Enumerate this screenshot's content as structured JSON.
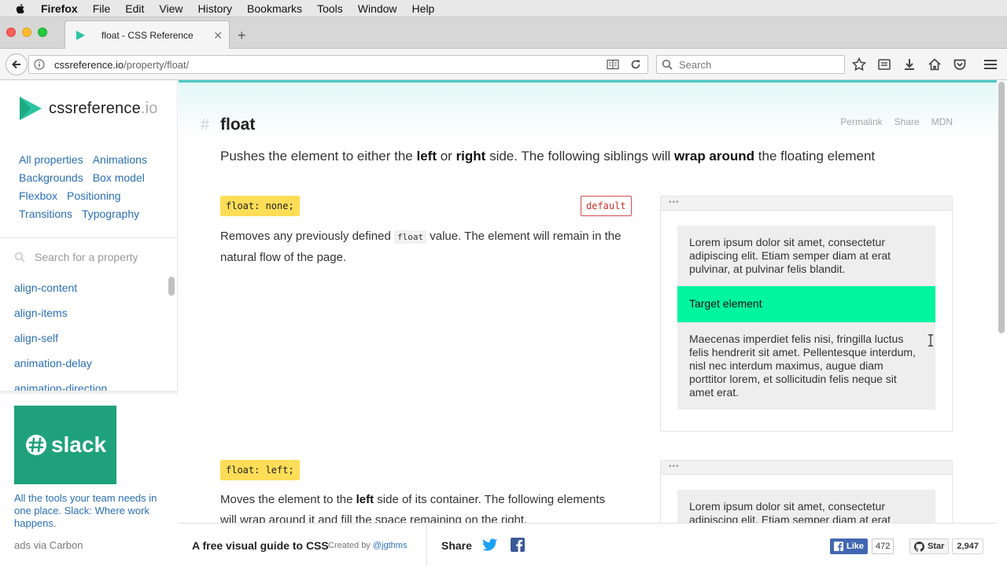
{
  "menubar": {
    "app": "Firefox",
    "items": [
      "File",
      "Edit",
      "View",
      "History",
      "Bookmarks",
      "Tools",
      "Window",
      "Help"
    ]
  },
  "tab": {
    "title": "float - CSS Reference"
  },
  "navbar": {
    "url_host": "cssreference.io",
    "url_path": "/property/float/",
    "search_placeholder": "Search"
  },
  "sidebar": {
    "logo_word": "cssreference",
    "logo_tld": ".io",
    "categories": [
      "All properties",
      "Animations",
      "Backgrounds",
      "Box model",
      "Flexbox",
      "Positioning",
      "Transitions",
      "Typography"
    ],
    "search_placeholder": "Search for a property",
    "properties": [
      "align-content",
      "align-items",
      "align-self",
      "animation-delay",
      "animation-direction"
    ]
  },
  "ad": {
    "brand": "slack",
    "copy": "All the tools your team needs in one place. Slack: Where work happens.",
    "via": "ads via Carbon"
  },
  "page": {
    "title": "float",
    "links": [
      "Permalink",
      "Share",
      "MDN"
    ],
    "lead": {
      "p1": "Pushes the element to either the ",
      "b1": "left",
      "p2": " or ",
      "b2": "right",
      "p3": " side. The following siblings will ",
      "b3": "wrap around",
      "p4": " the floating element"
    },
    "examples": [
      {
        "code": "float: none;",
        "default_label": "default",
        "desc_p1": "Removes any previously defined ",
        "desc_code": "float",
        "desc_p2": " value. The element will remain in the natural flow of the page.",
        "demo_before": "Lorem ipsum dolor sit amet, consectetur adipiscing elit. Etiam semper diam at erat pulvinar, at pulvinar felis blandit.",
        "demo_target": "Target element",
        "demo_after": "Maecenas imperdiet felis nisi, fringilla luctus felis hendrerit sit amet. Pellentesque interdum, nisl nec interdum maximus, augue diam porttitor lorem, et sollicitudin felis neque sit amet erat."
      },
      {
        "code": "float: left;",
        "desc_p1": "Moves the element to the ",
        "desc_b": "left",
        "desc_p2": " side of its container. The following elements will wrap around it and fill the space remaining on the right.",
        "demo_before": "Lorem ipsum dolor sit amet, consectetur adipiscing elit. Etiam semper diam at erat"
      }
    ]
  },
  "footer": {
    "guide": "A free visual guide to CSS",
    "created_by": "Created by ",
    "author": "@jgthms",
    "share": "Share",
    "like_label": "Like",
    "like_count": "472",
    "star_label": "Star",
    "star_count": "2,947"
  },
  "colors": {
    "accent": "#4ac9c4",
    "target": "#00f5a0",
    "code_tag": "#ffdd57",
    "link": "#2a6fb5"
  }
}
